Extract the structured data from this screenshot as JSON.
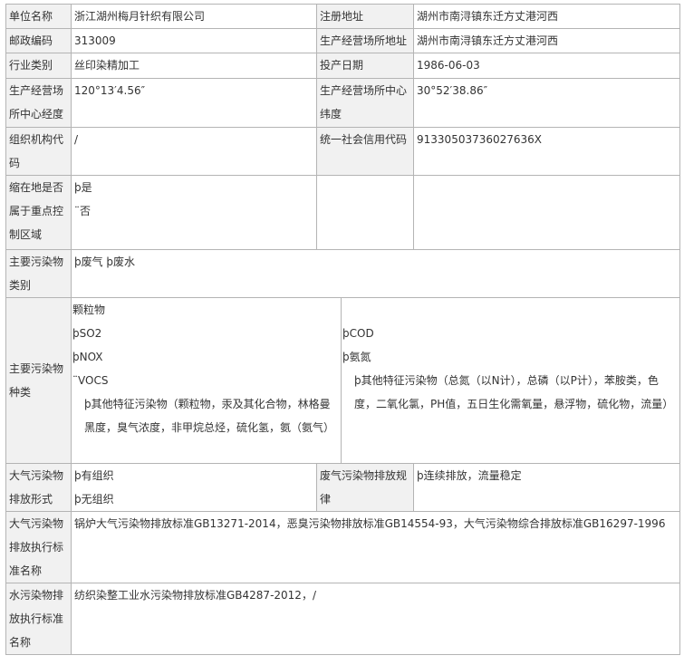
{
  "row1": {
    "label": "单位名称",
    "value": "浙江湖州梅月针织有限公司",
    "label2": "注册地址",
    "value2": "湖州市南浔镇东迁方丈港河西"
  },
  "row2": {
    "label": "邮政编码",
    "value": "313009",
    "label2": "生产经营场所地址",
    "value2": "湖州市南浔镇东迁方丈港河西"
  },
  "row3": {
    "label": "行业类别",
    "value": "丝印染精加工",
    "label2": "投产日期",
    "value2": "1986-06-03"
  },
  "row4": {
    "label": "生产经营场所中心经度",
    "value": "120°13′4.56″",
    "label2": "生产经营场所中心纬度",
    "value2": "30°52′38.86″"
  },
  "row5": {
    "label": "组织机构代码",
    "value": "/",
    "label2": "统一社会信用代码",
    "value2": "91330503736027636X"
  },
  "row6": {
    "label": "缩在地是否属于重点控制区域",
    "opt1": "þ是",
    "opt2": "¨否"
  },
  "row7": {
    "label": "主要污染物类别",
    "value": "þ废气  þ废水"
  },
  "row8": {
    "label": "主要污染物种类",
    "air_items": [
      "颗粒物",
      "þSO2",
      "þNOX",
      "¨VOCS"
    ],
    "air_other": "þ其他特征污染物（颗粒物，汞及其化合物，林格曼黑度，臭气浓度，非甲烷总烃，硫化氢，氨（氨气）",
    "water_items": [
      "þCOD",
      "þ氨氮"
    ],
    "water_other": "þ其他特征污染物（总氮（以N计），总磷（以P计），苯胺类，色度，二氧化氯，PH值，五日生化需氧量，悬浮物，硫化物，流量）"
  },
  "row9": {
    "label": "大气污染物排放形式",
    "opt1": "þ有组织",
    "opt2": "þ无组织",
    "label2": "废气污染物排放规律",
    "value2": "þ连续排放，流量稳定"
  },
  "row10": {
    "label": "大气污染物排放执行标准名称",
    "value": "锅炉大气污染物排放标准GB13271-2014，恶臭污染物排放标准GB14554-93，大气污染物综合排放标准GB16297-1996"
  },
  "row11": {
    "label": "水污染物排放执行标准名称",
    "value": "纺织染整工业水污染物排放标准GB4287-2012，/"
  }
}
